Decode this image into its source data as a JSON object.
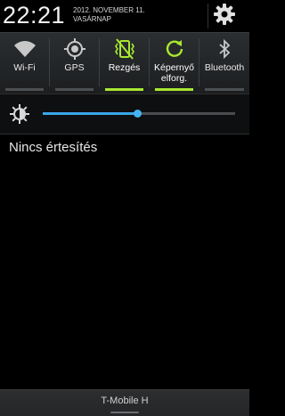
{
  "header": {
    "time": "22:21",
    "date": "2012. NOVEMBER 11.",
    "weekday": "VASÁRNAP",
    "settings_icon": "gear-icon"
  },
  "toggles": [
    {
      "label": "Wi-Fi",
      "icon": "wifi-icon",
      "on": false
    },
    {
      "label": "GPS",
      "icon": "gps-icon",
      "on": false
    },
    {
      "label": "Rezgés",
      "icon": "vibrate-icon",
      "on": true
    },
    {
      "label_line1": "Képernyő",
      "label_line2": "elforg.",
      "icon": "rotate-icon",
      "on": true
    },
    {
      "label": "Bluetooth",
      "icon": "bluetooth-icon",
      "on": false
    }
  ],
  "brightness": {
    "icon": "brightness-icon",
    "level": 0.49
  },
  "notifications": {
    "empty_text": "Nincs értesítés"
  },
  "footer": {
    "carrier": "T-Mobile H"
  },
  "colors": {
    "active": "#a8e830",
    "inactive_bar": "#4b4f52",
    "slider": "#3aa6e8"
  }
}
